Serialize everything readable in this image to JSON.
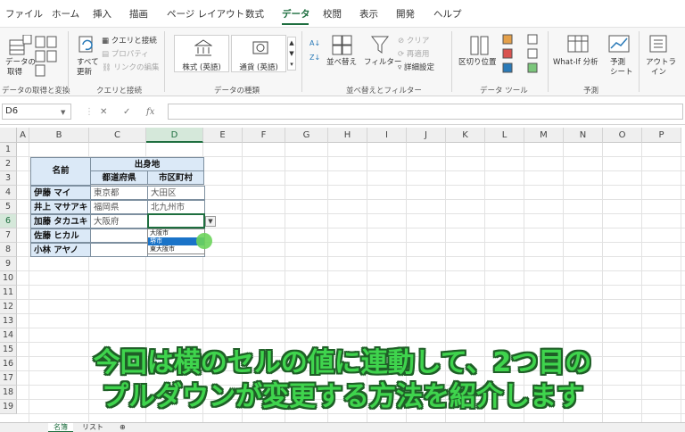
{
  "ribbon_tabs": [
    {
      "label": "ファイル",
      "active": false
    },
    {
      "label": "ホーム",
      "active": false
    },
    {
      "label": "挿入",
      "active": false
    },
    {
      "label": "描画",
      "active": false
    },
    {
      "label": "ページ レイアウト",
      "active": false
    },
    {
      "label": "数式",
      "active": false
    },
    {
      "label": "データ",
      "active": true
    },
    {
      "label": "校閲",
      "active": false
    },
    {
      "label": "表示",
      "active": false
    },
    {
      "label": "開発",
      "active": false
    },
    {
      "label": "ヘルプ",
      "active": false
    }
  ],
  "ribbon": {
    "get_data": {
      "label1": "データの",
      "label2": "取得",
      "group": "データの取得と変換"
    },
    "refresh": {
      "label1": "すべて",
      "label2": "更新",
      "group": "クエリと接続"
    },
    "queries_connections": "クエリと接続",
    "properties": "プロパティ",
    "edit_links": "リンクの編集",
    "stocks": "株式 (英語)",
    "currencies": "通貨 (英語)",
    "datatypes_group": "データの種類",
    "sort": "並べ替え",
    "filter": "フィルター",
    "clear": "クリア",
    "reapply": "再適用",
    "advanced": "詳細設定",
    "sortfilter_group": "並べ替えとフィルター",
    "text_to_columns": "区切り位置",
    "datatools_group": "データ ツール",
    "whatif": "What-If 分析",
    "forecast1": "予測",
    "forecast2": "シート",
    "outline1": "アウトラ",
    "outline2": "イン",
    "forecast_group": "予測"
  },
  "formula_bar": {
    "name_box": "D6",
    "cancel": "✕",
    "enter": "✓",
    "fx": "fx",
    "value": ""
  },
  "columns": [
    "A",
    "B",
    "C",
    "D",
    "E",
    "F",
    "G",
    "H",
    "I",
    "J",
    "K",
    "L",
    "M",
    "N",
    "O",
    "P"
  ],
  "rows": [
    "1",
    "2",
    "3",
    "4",
    "5",
    "6",
    "7",
    "8",
    "9",
    "10",
    "11",
    "12",
    "13",
    "14",
    "15",
    "16",
    "17",
    "18",
    "19"
  ],
  "table": {
    "name_header": "名前",
    "origin_header": "出身地",
    "pref_header": "都道府県",
    "city_header": "市区町村",
    "people": [
      {
        "name": "伊藤 マイ",
        "pref": "東京都",
        "city": "大田区"
      },
      {
        "name": "井上 マサアキ",
        "pref": "福岡県",
        "city": "北九州市"
      },
      {
        "name": "加藤 タカユキ",
        "pref": "大阪府",
        "city": ""
      },
      {
        "name": "佐藤 ヒカル",
        "pref": "",
        "city": ""
      },
      {
        "name": "小林 アヤノ",
        "pref": "",
        "city": ""
      }
    ]
  },
  "dropdown": {
    "options": [
      "大阪市",
      "堺市",
      "東大阪市"
    ],
    "highlighted": "堺市",
    "highlight_color": "#1a73c8"
  },
  "caption": {
    "line1": "今回は横のセルの値に連動して、2つ目の",
    "line2": "プルダウンが変更する方法を紹介します",
    "color": "#3fd44d"
  },
  "sheets": [
    {
      "label": "名簿",
      "active": true
    },
    {
      "label": "リスト",
      "active": false
    }
  ],
  "accent_color": "#1e6e3f"
}
